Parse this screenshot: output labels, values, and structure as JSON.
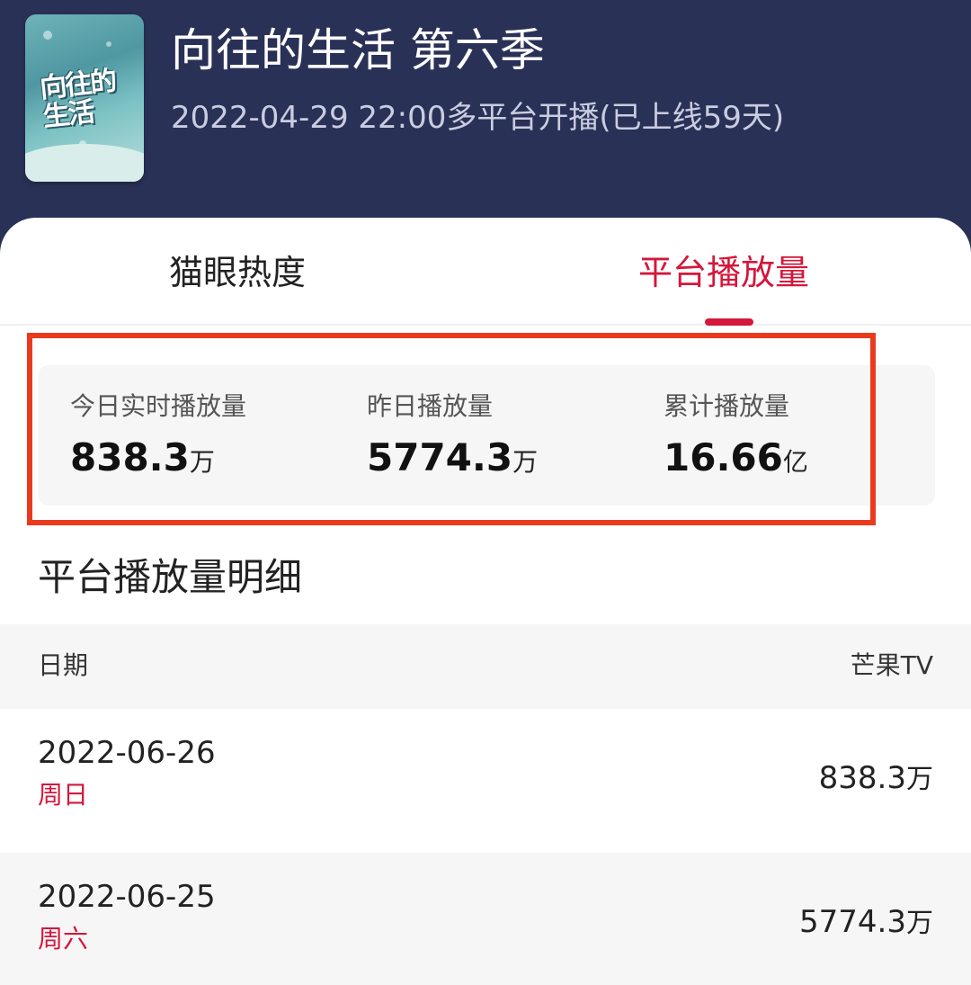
{
  "show": {
    "title": "向往的生活 第六季",
    "subtitle": "2022-04-29 22:00多平台开播(已上线59天)",
    "poster_text": "向往的生活"
  },
  "tabs": [
    {
      "label": "猫眼热度",
      "active": false
    },
    {
      "label": "平台播放量",
      "active": true
    }
  ],
  "stats": [
    {
      "label": "今日实时播放量",
      "value": "838.3",
      "unit": "万"
    },
    {
      "label": "昨日播放量",
      "value": "5774.3",
      "unit": "万"
    },
    {
      "label": "累计播放量",
      "value": "16.66",
      "unit": "亿"
    }
  ],
  "section_title": "平台播放量明细",
  "table": {
    "headers": {
      "date": "日期",
      "platform": "芒果TV"
    },
    "rows": [
      {
        "date": "2022-06-26",
        "weekday": "周日",
        "value": "838.3",
        "unit": "万"
      },
      {
        "date": "2022-06-25",
        "weekday": "周六",
        "value": "5774.3",
        "unit": "万"
      }
    ]
  },
  "colors": {
    "header_bg": "#2a3157",
    "accent": "#d4173b",
    "highlight_border": "#ea3a1e",
    "panel_bg": "#f6f6f7"
  }
}
